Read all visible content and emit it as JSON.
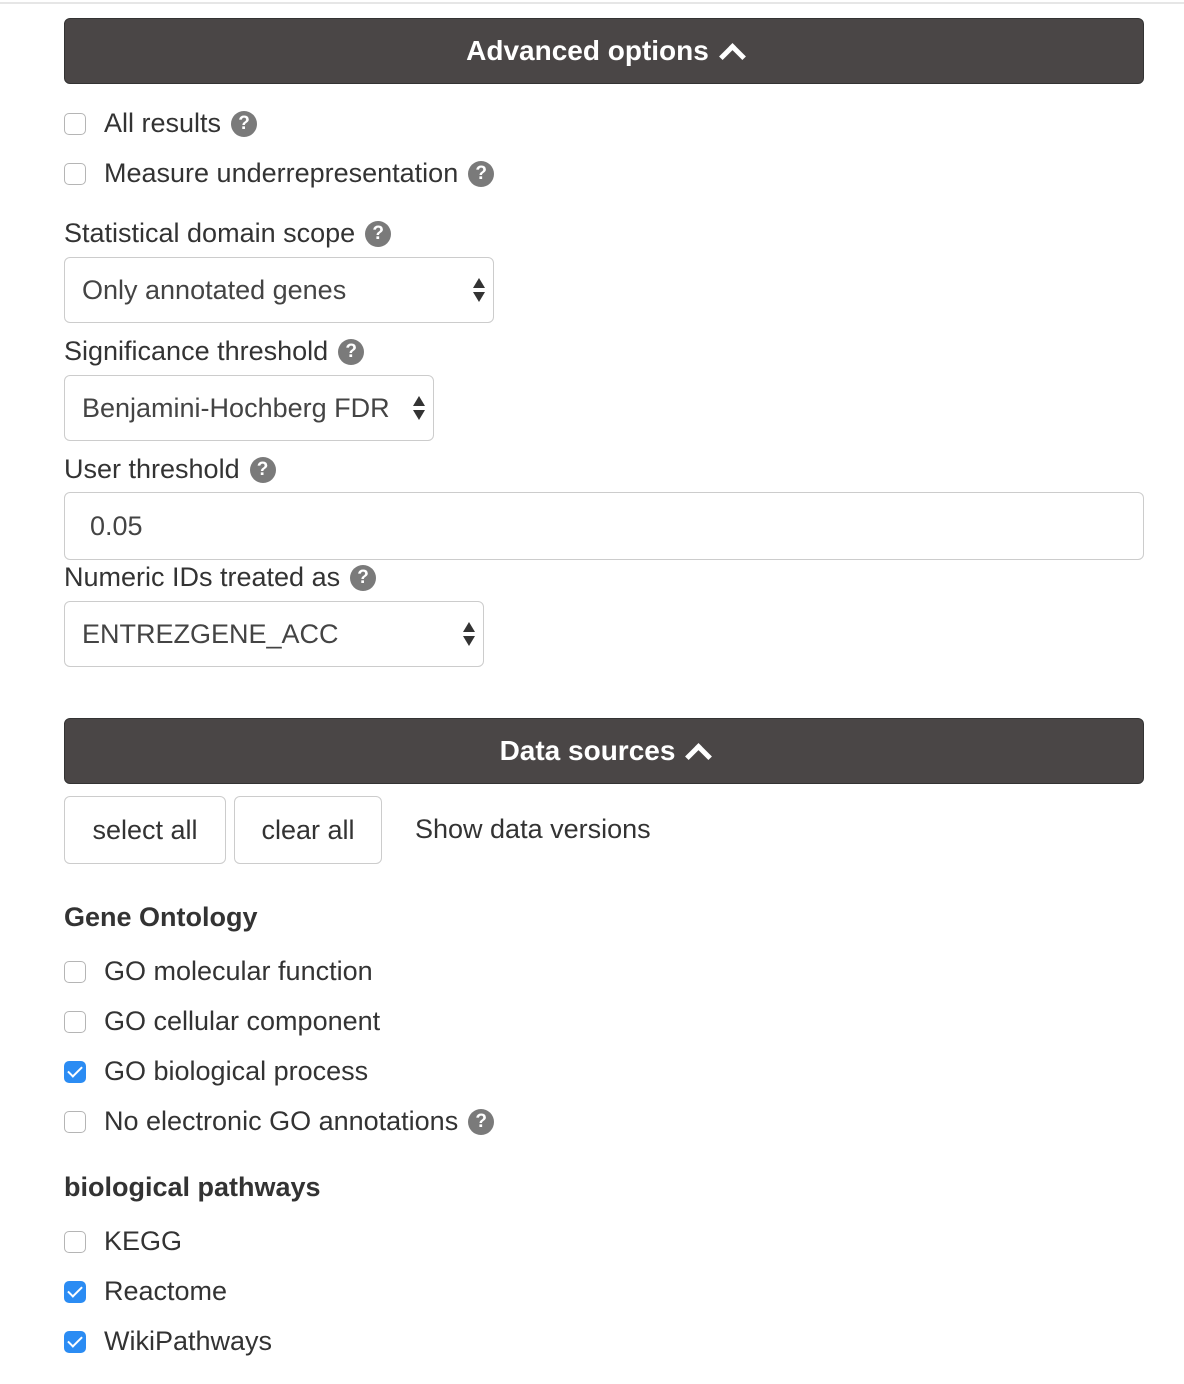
{
  "advanced": {
    "header": "Advanced options",
    "all_results": {
      "label": "All results",
      "checked": false
    },
    "underrepresentation": {
      "label": "Measure underrepresentation",
      "checked": false
    },
    "domain_scope": {
      "label": "Statistical domain scope",
      "value": "Only annotated genes"
    },
    "significance": {
      "label": "Significance threshold",
      "value": "Benjamini-Hochberg FDR"
    },
    "user_threshold": {
      "label": "User threshold",
      "value": "0.05"
    },
    "numeric_ids": {
      "label": "Numeric IDs treated as",
      "value": "ENTREZGENE_ACC"
    }
  },
  "sources": {
    "header": "Data sources",
    "select_all": "select all",
    "clear_all": "clear all",
    "show_versions": "Show data versions",
    "gene_ontology": {
      "title": "Gene Ontology",
      "items": [
        {
          "label": "GO molecular function",
          "checked": false
        },
        {
          "label": "GO cellular component",
          "checked": false
        },
        {
          "label": "GO biological process",
          "checked": true
        },
        {
          "label": "No electronic GO annotations",
          "checked": false
        }
      ]
    },
    "pathways": {
      "title": "biological pathways",
      "items": [
        {
          "label": "KEGG",
          "checked": false
        },
        {
          "label": "Reactome",
          "checked": true
        },
        {
          "label": "WikiPathways",
          "checked": true
        }
      ]
    }
  },
  "icons": {
    "help": "question-circle-icon",
    "collapse": "chevron-up-icon"
  },
  "colors": {
    "header_bg": "#4a4646",
    "check_blue": "#2b8cf3"
  }
}
